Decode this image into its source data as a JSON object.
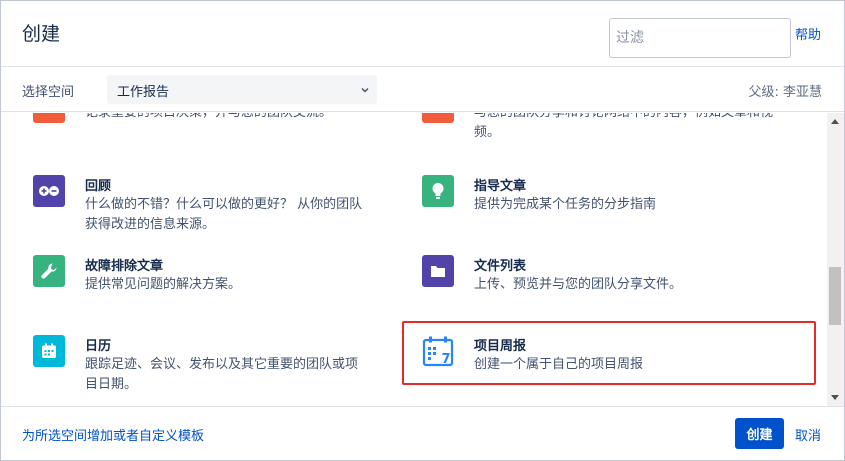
{
  "header": {
    "title": "创建",
    "filter_placeholder": "过滤",
    "help_label": "帮助"
  },
  "space": {
    "label": "选择空间",
    "selected": "工作报告",
    "parent": "父级: 李亚慧"
  },
  "templates": {
    "decision": {
      "desc": "记录重要的项目决策，并与您的团队交流。",
      "icon": "plus-icon",
      "color": "#f15c3b"
    },
    "share": {
      "desc": "与您的团队分享和讨论网络中的内容，例如文章和视频。",
      "icon": "share-icon",
      "color": "#f15c3b"
    },
    "retro": {
      "title": "回顾",
      "desc": "什么做的不错？什么可以做的更好？ 从你的团队获得改进的信息来源。",
      "icon": "plus-minus-icon",
      "color": "#5243aa"
    },
    "howto": {
      "title": "指导文章",
      "desc": "提供为完成某个任务的分步指南",
      "icon": "lightbulb-icon",
      "color": "#36b37e"
    },
    "troubleshoot": {
      "title": "故障排除文章",
      "desc": "提供常见问题的解决方案。",
      "icon": "wrench-icon",
      "color": "#36b37e"
    },
    "filelist": {
      "title": "文件列表",
      "desc": "上传、预览并与您的团队分享文件。",
      "icon": "folder-icon",
      "color": "#5243aa"
    },
    "calendar": {
      "title": "日历",
      "desc": "跟踪足迹、会议、发布以及其它重要的团队或项目日期。",
      "icon": "calendar-icon",
      "color": "#00b8d9"
    },
    "weekly": {
      "title": "项目周报",
      "desc": "创建一个属于自己的项目周报",
      "icon": "weekly-calendar-icon",
      "icon_number": "7",
      "color": "#2684ff"
    }
  },
  "footer": {
    "add_template_link": "为所选空间增加或者自定义模板",
    "create_label": "创建",
    "cancel_label": "取消"
  }
}
